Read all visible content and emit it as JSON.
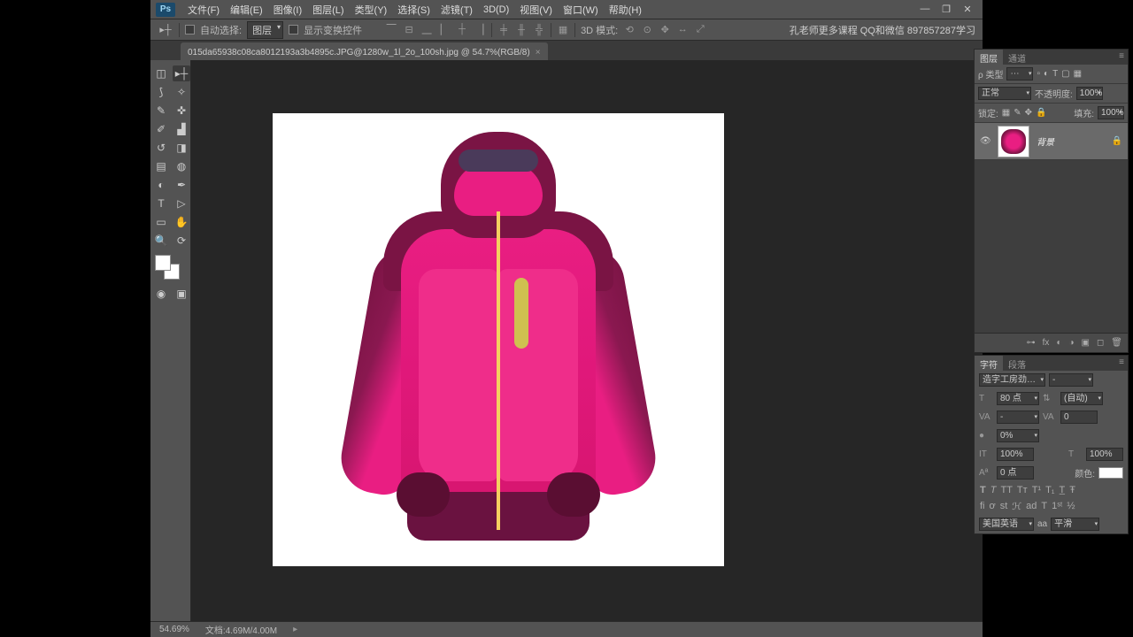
{
  "menubar": {
    "items": [
      "文件(F)",
      "编辑(E)",
      "图像(I)",
      "图层(L)",
      "类型(Y)",
      "选择(S)",
      "滤镜(T)",
      "3D(D)",
      "视图(V)",
      "窗口(W)",
      "帮助(H)"
    ]
  },
  "optbar": {
    "auto_select": "自动选择:",
    "auto_select_value": "图层",
    "show_transform": "显示变换控件",
    "mode_label": "3D 模式:",
    "course": "孔老师更多课程 QQ和微信 897857287学习"
  },
  "doctab": {
    "title": "015da65938c08ca8012193a3b4895c.JPG@1280w_1l_2o_100sh.jpg @ 54.7%(RGB/8)"
  },
  "layers_panel": {
    "tab1": "图层",
    "tab2": "通道",
    "kind_label": "ρ 类型",
    "blend_mode": "正常",
    "opacity_label": "不透明度:",
    "opacity_value": "100%",
    "lock_label": "锁定:",
    "fill_label": "填充:",
    "fill_value": "100%",
    "layer_name": "背景"
  },
  "char_panel": {
    "tab1": "字符",
    "tab2": "段落",
    "font": "造字工房劲…",
    "font_style": "-",
    "size": "80 点",
    "leading": "(自动)",
    "va": "VA",
    "kerning": "0",
    "scale": "0%",
    "vscale": "100%",
    "hscale": "100%",
    "baseline": "0 点",
    "color_label": "颜色:",
    "lang": "美国英语",
    "aa_label": "aa",
    "aa": "平滑"
  },
  "status": {
    "zoom": "54.69%",
    "doc": "文档:4.69M/4.00M"
  }
}
